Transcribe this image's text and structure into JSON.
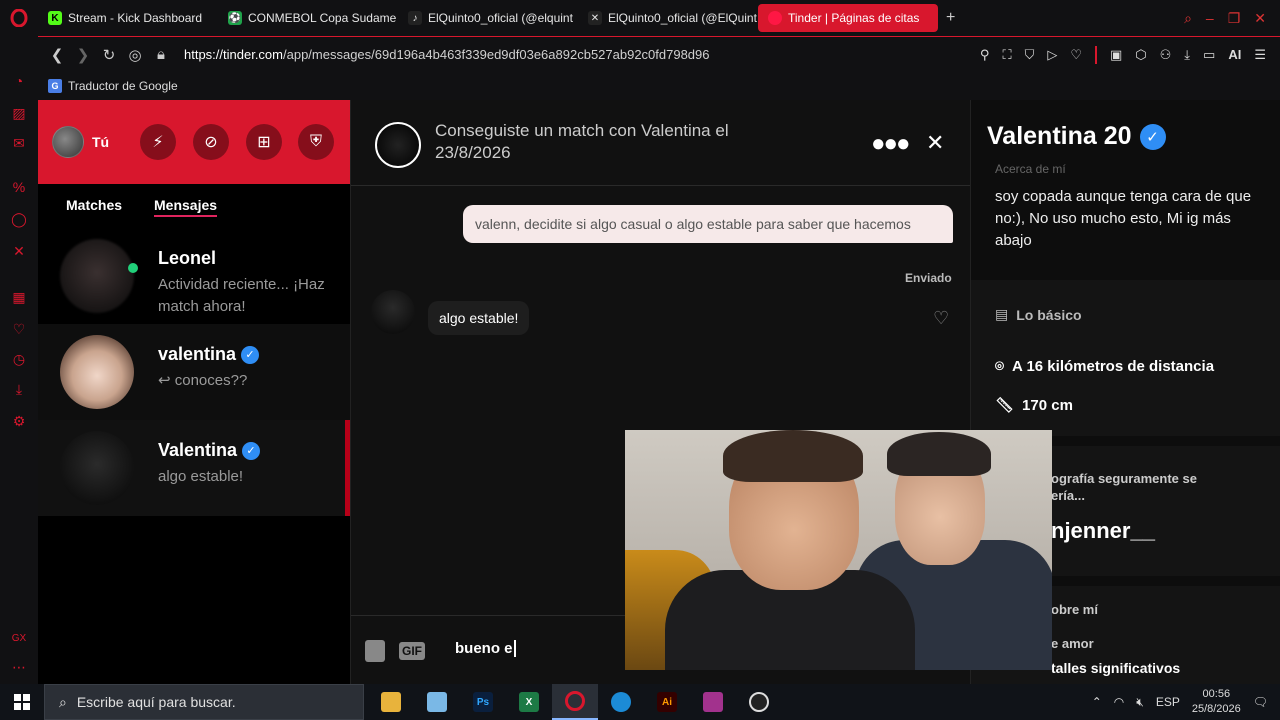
{
  "browser": {
    "tabs": [
      {
        "label": "Stream - Kick Dashboard",
        "color": "#53fc18",
        "glyph": "K"
      },
      {
        "label": "CONMEBOL Copa Sudame",
        "color": "#1fa34a",
        "glyph": "⚽"
      },
      {
        "label": "ElQuinto0_oficial (@elquint",
        "color": "#222222",
        "glyph": "♪"
      },
      {
        "label": "ElQuinto0_oficial (@ElQuint",
        "color": "#222222",
        "glyph": "✕"
      },
      {
        "label": "Tinder | Páginas de citas",
        "color": "#fe3c72",
        "glyph": "●"
      }
    ],
    "url_host": "https://tinder.com",
    "url_path": "/app/messages/69d196a4b463f339ed9df03e6a892cb527ab92c0fd798d96",
    "bookmark": "Traductor de Google",
    "addr_ai": "AI"
  },
  "tinder": {
    "me_label": "Tú",
    "tabs": {
      "matches": "Matches",
      "messages": "Mensajes"
    },
    "conversations": [
      {
        "name": "Leonel",
        "message": "Actividad reciente... ¡Haz match ahora!"
      },
      {
        "name": "valentina",
        "message": "↩ conoces??"
      },
      {
        "name": "Valentina",
        "message": "algo estable!"
      }
    ],
    "chat": {
      "title": "Conseguiste un match con Valentina el 23/8/2026",
      "sent_message": "valenn, decidite si algo casual o algo estable para saber que hacemos",
      "sent_status": "Enviado",
      "received_message": "algo estable!",
      "gif_label": "GIF",
      "input_value": "bueno e"
    },
    "profile": {
      "name_age": "Valentina 20",
      "faded_label": "Acerca de mí",
      "bio": "soy copada aunque tenga cara de que no:), No uso mucho esto, Mi ig más abajo",
      "basics_title": "Lo básico",
      "distance": "A 16 kilómetros de distancia",
      "height": "170 cm",
      "photo_hint": "ografía seguramente se\nería...",
      "instagram_partial": "njenner__",
      "about_partial": "obre mí",
      "love_partial": "e amor",
      "details_partial": "talles significativos"
    }
  },
  "taskbar": {
    "search_placeholder": "Escribe aquí para buscar.",
    "language": "ESP",
    "time": "00:56",
    "date": "25/8/2026"
  },
  "colors": {
    "brand": "#d8172d",
    "verified": "#2f8ef5",
    "online": "#21d07a"
  }
}
